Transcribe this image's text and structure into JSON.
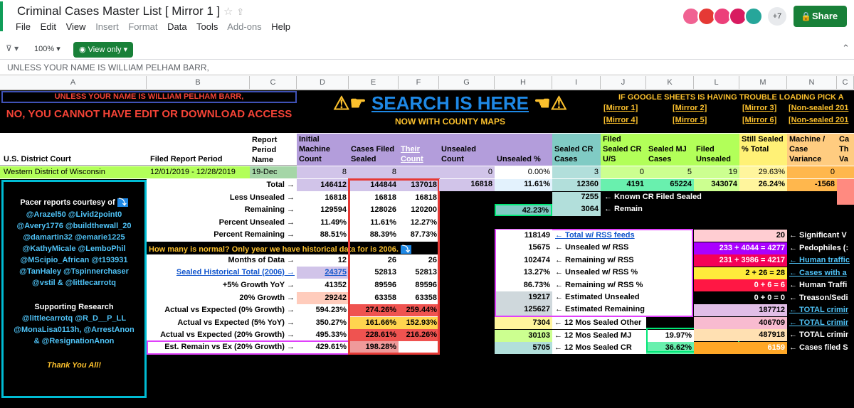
{
  "doc": {
    "title": "Criminal Cases Master List [ Mirror 1 ]",
    "menu": [
      "File",
      "Edit",
      "View",
      "Insert",
      "Format",
      "Data",
      "Tools",
      "Add-ons",
      "Help"
    ],
    "avatar_more": "+7",
    "share_label": "Share",
    "zoom": "100%",
    "view_only": "View only",
    "formula_bar": "UNLESS YOUR NAME IS WILLIAM PELHAM BARR,"
  },
  "columns": [
    "A",
    "B",
    "C",
    "D",
    "E",
    "F",
    "G",
    "H",
    "I",
    "J",
    "K",
    "L",
    "M",
    "N",
    "C"
  ],
  "banner": {
    "unless": "UNLESS YOUR NAME IS WILLIAM PELHAM BARR,",
    "no_access": "NO, YOU CANNOT HAVE EDIT OR DOWNLOAD ACCESS",
    "search": "SEARCH IS HERE",
    "county": "NOW WITH COUNTY MAPS",
    "google": "IF GOOGLE SHEETS IS HAVING TROUBLE LOADING PICK A",
    "mirrors": [
      "[Mirror 1]",
      "[Mirror 2]",
      "[Mirror 3]",
      "[Non-sealed 201",
      "[Mirror 4]",
      "[Mirror 5]",
      "[Mirror 6]",
      "[Non-sealed 201"
    ]
  },
  "headers": {
    "court": "U.S. District Court",
    "filed_period": "Filed Report Period",
    "report_period": "Report Period Name",
    "initial": "Initial Machine Count",
    "cases_sealed": "Cases Filed Sealed",
    "their_count": "Their Count",
    "unsealed_count": "Unsealed Count",
    "unsealed_pct": "Unsealed %",
    "sealed_cr": "Sealed CR Cases",
    "filed_cru": "Filed Sealed CR U/S",
    "sealed_mj": "Sealed MJ Cases",
    "filed_unsealed": "Filed Unsealed",
    "still_sealed": "Still Sealed % Total",
    "machine_case": "Machine / Case Variance",
    "cut": "Ca Th Va"
  },
  "row1": {
    "court": "Western District of Wisconsin",
    "period": "12/01/2019 - 12/28/2019",
    "name": "19-Dec",
    "d": "8",
    "e": "8",
    "g": "0",
    "h": "0.00%",
    "i": "3",
    "j": "0",
    "k": "5",
    "l": "19",
    "m": "29.63%",
    "n": "0"
  },
  "left_panel": {
    "pacer": "Pacer reports courtesy of",
    "handles": [
      "@Arazel50 @Livid2point0",
      "@Avery1776 @buildthewall_20",
      "@damartin32 @emarie1225",
      "@KathyMicale @LemboPhil",
      "@MScipio_African @t193931",
      "@TanHaley @Tspinnerchaser",
      "@vstil & @littlecarrotq"
    ],
    "supporting": "Supporting Research",
    "support_handles": [
      "@littlecarrotq @R_D__P_LL",
      "@MonaLisa0113h, @ArrestAnon",
      "& @ResignationAnon"
    ],
    "thanks": "Thank You All!"
  },
  "rows": [
    {
      "label": "Total →",
      "d": "146412",
      "e": "144844",
      "f": "137018",
      "g": "16818",
      "h": "11.61%",
      "i": "12360",
      "j": "4191",
      "k": "65224",
      "l": "343074",
      "m": "26.24%",
      "n": "-1568"
    },
    {
      "label": "Less Unsealed →",
      "d": "16818",
      "e": "16818",
      "f": "16818",
      "i": "7255",
      "inote": "← Known CR Filed Sealed"
    },
    {
      "label": "Remaining →",
      "d": "129594",
      "e": "128026",
      "f": "120200",
      "h": "42.23%",
      "i": "3064",
      "inote": "← Remain"
    },
    {
      "label": "Percent Unsealed →",
      "d": "11.49%",
      "e": "11.61%",
      "f": "12.27%"
    },
    {
      "label": "Percent Remaining →",
      "d": "88.51%",
      "e": "88.39%",
      "f": "87.73%"
    },
    {
      "label": "How many is normal? Only year we have historical data for is 2006."
    },
    {
      "label": "Months of Data →",
      "d": "12",
      "e": "26",
      "f": "26"
    },
    {
      "label": "Sealed Historical Total (2006) →",
      "d": "24375",
      "e": "52813",
      "f": "52813"
    },
    {
      "label": "+5% Growth YoY →",
      "d": "41352",
      "e": "89596",
      "f": "89596"
    },
    {
      "label": "20% Growth →",
      "d": "29242",
      "e": "63358",
      "f": "63358"
    },
    {
      "label": "Actual vs Expected (0% Growth) →",
      "d": "594.23%",
      "e": "274.26%",
      "f": "259.44%"
    },
    {
      "label": "Actual vs Expected (5% YoY) →",
      "d": "350.27%",
      "e": "161.66%",
      "f": "152.93%"
    },
    {
      "label": "Actual vs Expected (20% Growth) →",
      "d": "495.33%",
      "e": "228.61%",
      "f": "216.26%"
    },
    {
      "label": "Est. Remain vs Ex (20% Growth) →",
      "d": "429.61%",
      "e": "198.28%"
    }
  ],
  "rss": [
    {
      "v": "118149",
      "t": "← Total w/ RSS feeds"
    },
    {
      "v": "15675",
      "t": "← Unsealed w/ RSS"
    },
    {
      "v": "102474",
      "t": "← Remaining w/ RSS"
    },
    {
      "v": "13.27%",
      "t": "← Unsealed w/ RSS %"
    },
    {
      "v": "86.73%",
      "t": "← Remaining w/ RSS %"
    },
    {
      "v": "19217",
      "t": "← Estimated Unsealed"
    },
    {
      "v": "125627",
      "t": "← Estimated Remaining"
    }
  ],
  "months12": [
    {
      "v": "7304",
      "t": "← 12 Mos Sealed Other"
    },
    {
      "v": "30103",
      "t": "← 12 Mos Sealed MJ",
      "p": "19.97%"
    },
    {
      "v": "5705",
      "t": "← 12 Mos Sealed CR",
      "p": "36.62%"
    }
  ],
  "right_list": [
    {
      "v": "20",
      "t": "← Significant V"
    },
    {
      "v": "233 + 4044 = 4277",
      "t": "← Pedophiles (:"
    },
    {
      "v": "231 + 3986 = 4217",
      "t": "← Human traffic"
    },
    {
      "v": "2 + 26 = 28",
      "t": "← Cases with a"
    },
    {
      "v": "0 + 6 = 6",
      "t": "← Human Traffi"
    },
    {
      "v": "0 + 0 = 0",
      "t": "← Treason/Sedi"
    },
    {
      "v": "187712",
      "t": "← TOTAL crimir"
    },
    {
      "v": "406709",
      "t": "← TOTAL crimir"
    },
    {
      "v": "487918",
      "t": "← TOTAL crimir"
    },
    {
      "v": "6159",
      "t": "← Cases filed S"
    }
  ]
}
